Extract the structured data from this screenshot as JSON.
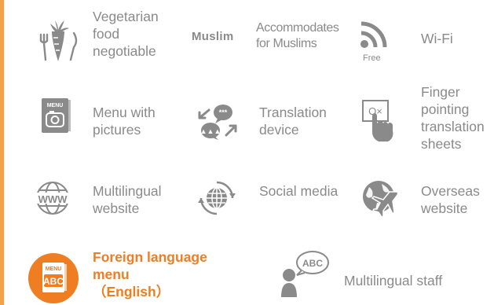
{
  "colors": {
    "icon_gray": "#8a8a8a",
    "accent_orange": "#ef7d22",
    "accent_bar": "#f3a24a"
  },
  "features": [
    {
      "id": "vegetarian",
      "icon": "carrot-utensils-icon",
      "label": "Vegetarian food negotiable"
    },
    {
      "id": "muslim",
      "icon": "muslim-text-icon",
      "icon_text": "Muslim",
      "label": "Accommodates for Muslims"
    },
    {
      "id": "wifi",
      "icon": "wifi-icon",
      "icon_text": "Free",
      "label": "Wi-Fi"
    },
    {
      "id": "picture-menu",
      "icon": "camera-menu-icon",
      "icon_text": "MENU",
      "label": "Menu with pictures"
    },
    {
      "id": "translation-device",
      "icon": "translation-chat-icon",
      "label": "Translation device"
    },
    {
      "id": "pointing-sheets",
      "icon": "pointing-hand-icon",
      "icon_text": "O×",
      "label": "Finger pointing translation sheets"
    },
    {
      "id": "multilingual-website",
      "icon": "www-globe-icon",
      "icon_text": "WWW",
      "label": "Multilingual website"
    },
    {
      "id": "social-media",
      "icon": "social-globe-icon",
      "label": "Social media"
    },
    {
      "id": "overseas-website",
      "icon": "plane-globe-icon",
      "label": "Overseas website"
    },
    {
      "id": "foreign-menu",
      "icon": "abc-menu-icon",
      "icon_text_top": "MENU",
      "icon_text_bottom": "ABC",
      "label_main": "Foreign language menu",
      "label_sub": "（English）",
      "active": true
    },
    {
      "id": "multilingual-staff",
      "icon": "staff-speech-icon",
      "icon_text": "ABC",
      "label": "Multilingual staff"
    }
  ]
}
